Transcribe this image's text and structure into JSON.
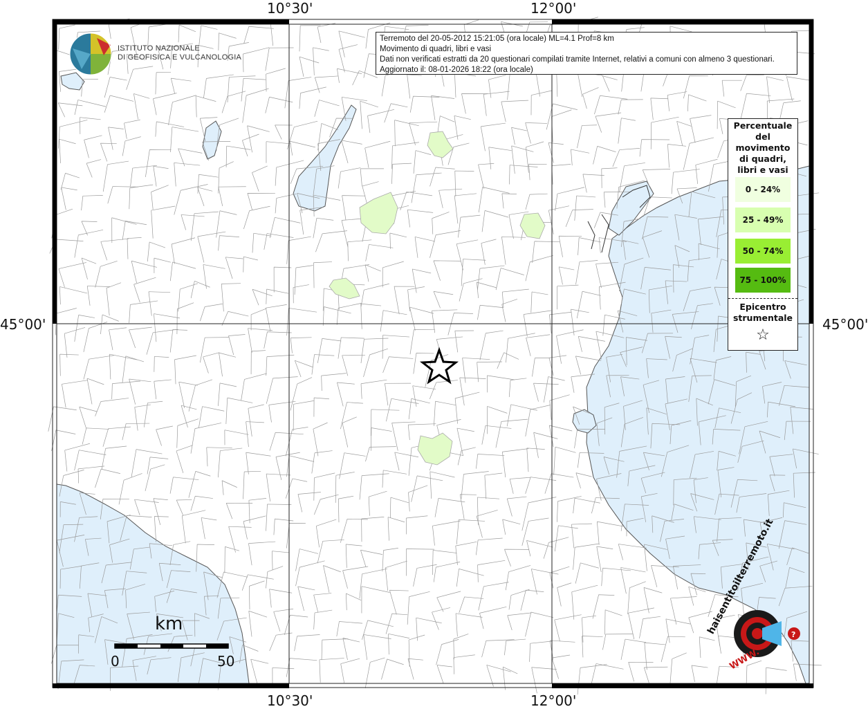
{
  "map": {
    "top_labels": [
      "10°30'",
      "12°00'"
    ],
    "bottom_labels": [
      "10°30'",
      "12°00'"
    ],
    "left_labels": [
      "45°00'"
    ],
    "right_labels": [
      "45°00'"
    ]
  },
  "info_box": {
    "line1": "Terremoto del 20-05-2012 15:21:05 (ora locale) ML=4.1 Prof=8 km",
    "line2": "Movimento di quadri, libri e vasi",
    "line3": "Dati non verificati estratti da 20 questionari compilati tramite Internet, relativi a comuni con almeno 3 questionari.",
    "line4": "Aggiornato il: 08-01-2026 18:22 (ora locale)"
  },
  "legend": {
    "title": "Percentuale del movimento di quadri, libri e vasi",
    "classes": [
      {
        "label": "0 - 24%",
        "color": "#f0ffe0"
      },
      {
        "label": "25 - 49%",
        "color": "#d8ffb0"
      },
      {
        "label": "50 - 74%",
        "color": "#99ee33"
      },
      {
        "label": "75 - 100%",
        "color": "#55bb11"
      }
    ],
    "epicenter_label": "Epicentro strumentale",
    "epicenter_symbol": "☆"
  },
  "scale_bar": {
    "title": "km",
    "start": "0",
    "end": "50"
  },
  "logo": {
    "line1": "ISTITUTO NAZIONALE",
    "line2": "DI GEOFISICA E VULCANOLOGIA"
  },
  "badge": {
    "text": "haisentitoilterremoto.it",
    "www": "WWW."
  },
  "colors": {
    "sea": "#dfeffb",
    "land": "#ffffff",
    "borders": "#9a9a9a",
    "affected": "#e2fbc8"
  }
}
